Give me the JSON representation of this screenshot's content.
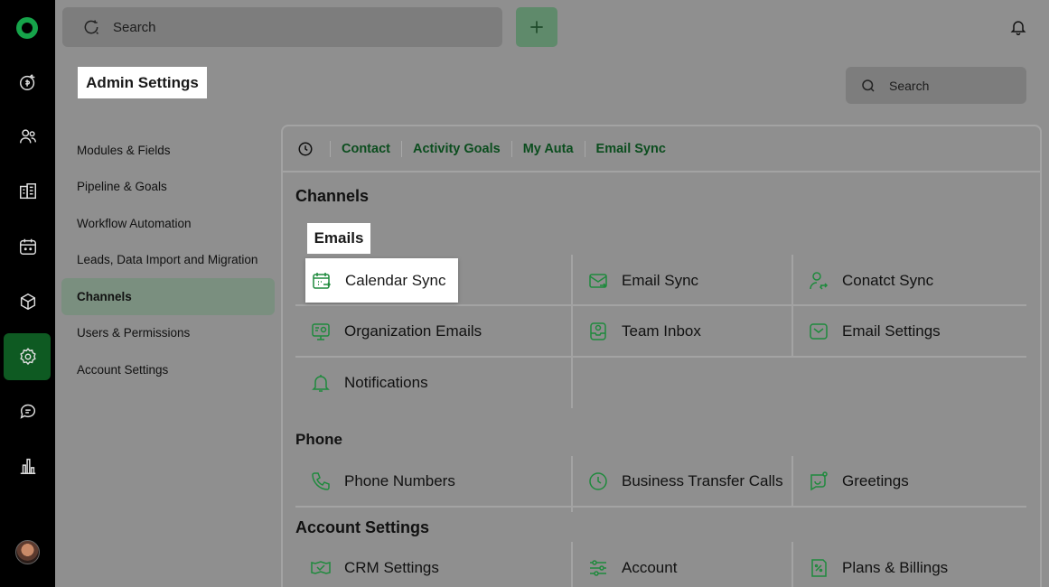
{
  "topbar": {
    "search_placeholder": "Search"
  },
  "header": {
    "title": "Admin Settings",
    "search_placeholder": "Search"
  },
  "settings_nav": [
    "Modules & Fields",
    "Pipeline & Goals",
    "Workflow Automation",
    "Leads, Data Import and Migration",
    "Channels",
    "Users & Permissions",
    "Account Settings"
  ],
  "tabs": [
    "Contact",
    "Activity Goals",
    "My Auta",
    "Email Sync"
  ],
  "main": {
    "title": "Channels",
    "emails": {
      "title": "Emails",
      "items": [
        "Calendar Sync",
        "Email Sync",
        "Conatct Sync",
        "Organization Emails",
        "Team Inbox",
        "Email Settings",
        "Notifications"
      ]
    },
    "phone": {
      "title": "Phone",
      "items": [
        "Phone Numbers",
        "Business Transfer Calls",
        "Greetings"
      ]
    },
    "account": {
      "title": "Account Settings",
      "items": [
        "CRM Settings",
        "Account",
        "Plans & Billings"
      ]
    }
  },
  "colors": {
    "accent": "#0b4d1e",
    "icon": "#1f8a3d",
    "active_rail": "#0e5a22"
  }
}
